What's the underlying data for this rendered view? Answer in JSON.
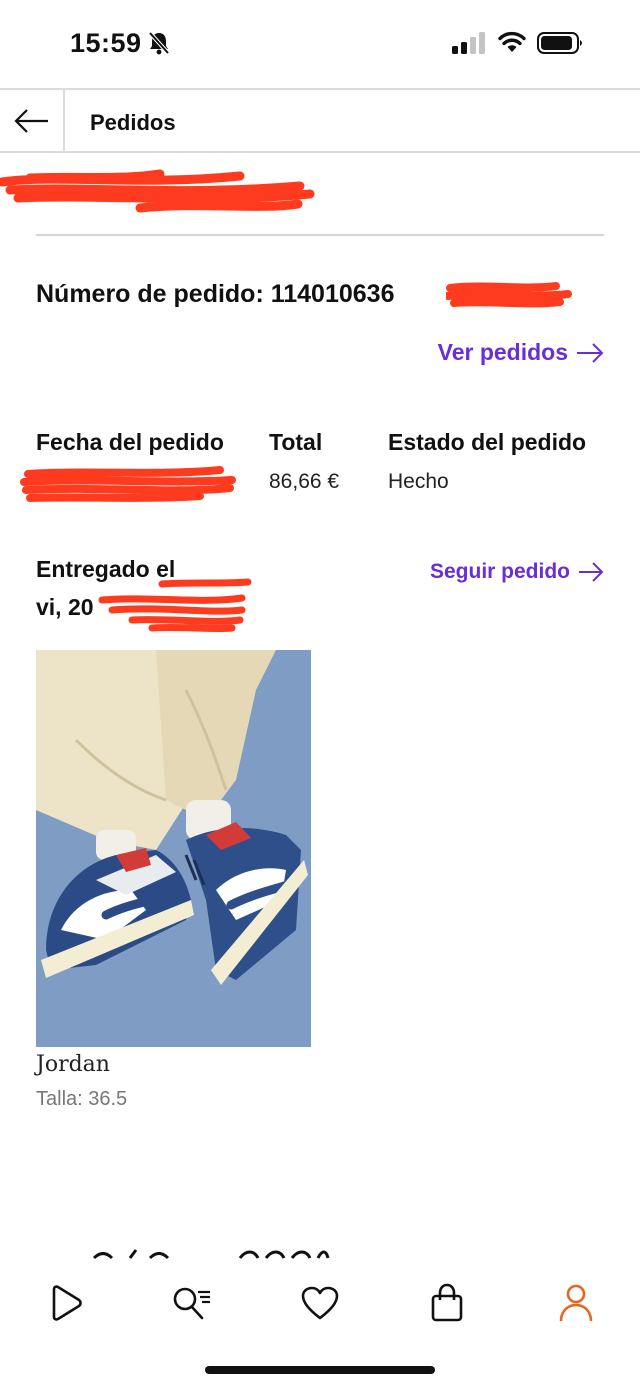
{
  "status_bar": {
    "time": "15:59",
    "icons": [
      "bell-slash-icon",
      "signal-icon",
      "wifi-icon",
      "battery-icon"
    ]
  },
  "nav": {
    "back_icon": "arrow-left-icon",
    "title": "Pedidos"
  },
  "order": {
    "number_label": "Número de pedido: 114010636",
    "view_orders": "Ver pedidos",
    "columns": [
      {
        "label": "Fecha del pedido",
        "value": ""
      },
      {
        "label": "Total",
        "value": "86,66 €"
      },
      {
        "label": "Estado del pedido",
        "value": "Hecho"
      }
    ],
    "delivered_label": "Entregado el",
    "delivered_date": "vi, 20",
    "track_order": "Seguir pedido"
  },
  "product": {
    "name": "Jordan",
    "size": "Talla: 36.5"
  },
  "tab_bar": {
    "tabs": [
      "play-icon",
      "search-list-icon",
      "heart-icon",
      "shopping-bag-icon",
      "profile-icon"
    ],
    "active_color": "#e8661f"
  },
  "colors": {
    "link": "#6a2ed8",
    "redaction": "#ff3b1f"
  }
}
